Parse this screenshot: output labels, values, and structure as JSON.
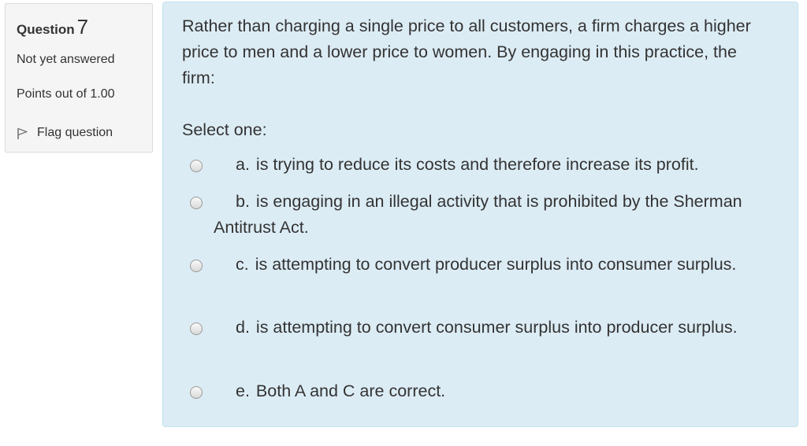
{
  "info": {
    "question_label": "Question",
    "question_number": "7",
    "state": "Not yet answered",
    "grade": "Points out of 1.00",
    "flag_label": "Flag question"
  },
  "question": {
    "text": "Rather than charging a single price to all customers, a firm charges a higher price to men and a lower price to women. By engaging in this practice, the firm:",
    "prompt": "Select one:",
    "options": [
      {
        "letter": "a.",
        "text": "is trying to reduce its costs and therefore increase its profit."
      },
      {
        "letter": "b.",
        "text": "is engaging in an illegal activity that is prohibited by the Sherman Antitrust Act."
      },
      {
        "letter": "c.",
        "text": "is attempting to convert producer surplus into consumer surplus."
      },
      {
        "letter": "d.",
        "text": "is attempting to convert consumer surplus into producer surplus."
      },
      {
        "letter": "e.",
        "text": "Both A and C are correct."
      }
    ]
  },
  "colors": {
    "content_bg": "#dcecf5",
    "content_border": "#c1e2ee",
    "info_bg": "#f5f5f5",
    "text": "#333333"
  }
}
